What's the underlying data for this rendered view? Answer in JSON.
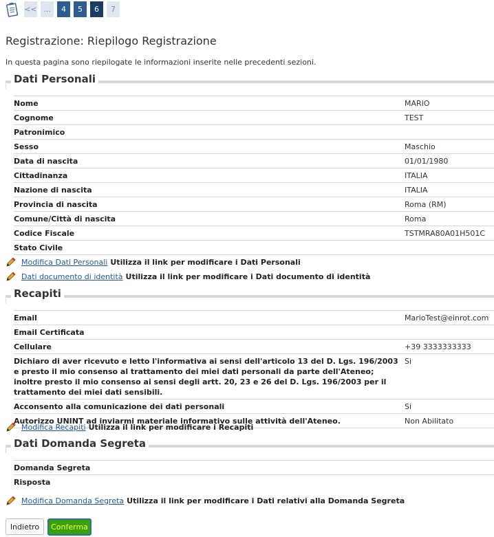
{
  "pager": {
    "items": [
      "<<",
      "...",
      "4",
      "5",
      "6",
      "7"
    ]
  },
  "page": {
    "title": "Registrazione: Riepilogo Registrazione",
    "intro": "In questa pagina sono riepilogate le informazioni inserite nelle precedenti sezioni."
  },
  "personali": {
    "legend": "Dati Personali",
    "rows": [
      {
        "label": "Nome",
        "value": "MARIO"
      },
      {
        "label": "Cognome",
        "value": "TEST"
      },
      {
        "label": "Patronimico",
        "value": ""
      },
      {
        "label": "Sesso",
        "value": "Maschio"
      },
      {
        "label": "Data di nascita",
        "value": "01/01/1980"
      },
      {
        "label": "Cittadinanza",
        "value": "ITALIA"
      },
      {
        "label": "Nazione di nascita",
        "value": "ITALIA"
      },
      {
        "label": "Provincia di nascita",
        "value": "Roma (RM)"
      },
      {
        "label": "Comune/Città di nascita",
        "value": "Roma"
      },
      {
        "label": "Codice Fiscale",
        "value": "TSTMRA80A01H501C"
      },
      {
        "label": "Stato Civile",
        "value": ""
      }
    ]
  },
  "actions": {
    "personali": {
      "link": "Modifica Dati Personali",
      "desc": "Utilizza il link per modificare i Dati Personali"
    },
    "documento": {
      "link": "Dati documento di identità",
      "desc": "Utilizza il link per modificare i Dati documento di identità"
    },
    "recapiti": {
      "link": "Modifica Recapiti",
      "desc": "Utilizza il link per modificare i Recapiti"
    },
    "domanda": {
      "link": "Modifica Domanda Segreta",
      "desc": "Utilizza il link per modificare i Dati relativi alla Domanda Segreta"
    }
  },
  "recapiti": {
    "legend": "Recapiti",
    "rows": [
      {
        "label": "Email",
        "value": "MarioTest@einrot.com"
      },
      {
        "label": "Email Certificata",
        "value": ""
      },
      {
        "label": "Cellulare",
        "value": "+39 3333333333"
      },
      {
        "label": "Dichiaro di aver ricevuto e letto l'informativa ai sensi dell'articolo 13 del D. Lgs. 196/2003 e presto il mio consenso al trattamento dei miei dati personali da parte dell'Ateneo; inoltre presto il mio consenso ai sensi degli artt. 20, 23 e 26 del D. Lgs. 196/2003 per il trattamento dei miei dati sensibili.",
        "value": "Si"
      },
      {
        "label": "Acconsento alla comunicazione dei dati personali",
        "value": "Si"
      },
      {
        "label": "Autorizzo UNINT ad inviarmi materiale informativo sulle attività dell'Ateneo.",
        "value": "Non Abilitato"
      }
    ]
  },
  "domanda": {
    "legend": "Dati Domanda Segreta",
    "rows": [
      {
        "label": "Domanda Segreta",
        "value": ""
      },
      {
        "label": "Risposta",
        "value": ""
      }
    ]
  },
  "buttons": {
    "back": "Indietro",
    "confirm": "Conferma"
  }
}
